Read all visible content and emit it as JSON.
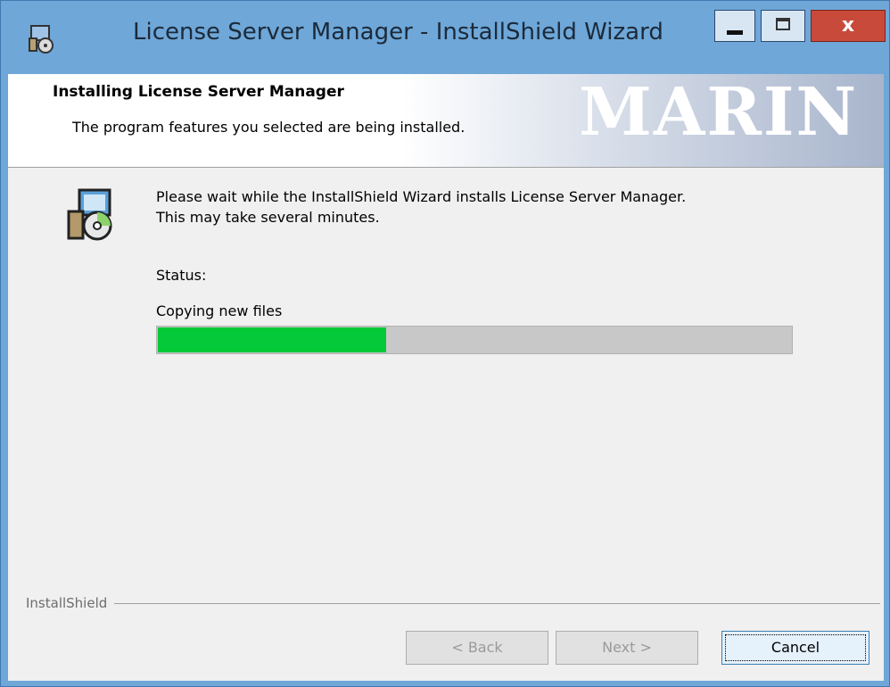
{
  "window": {
    "title": "License Server Manager - InstallShield Wizard",
    "title_buttons": {
      "minimize": "minimize",
      "maximize": "maximize",
      "close": "x"
    },
    "icon": "installer-icon"
  },
  "banner": {
    "title": "Installing License Server Manager",
    "subtitle": "The program features you selected are being installed.",
    "logo_text": "MARIN"
  },
  "body": {
    "message_line1": "Please wait while the InstallShield Wizard installs License Server Manager.",
    "message_line2": "This may take several minutes.",
    "status_label": "Status:",
    "status_value": "Copying new files",
    "progress_fraction": 0.36,
    "progress_color": "#06c93a"
  },
  "footer": {
    "brand": "InstallShield",
    "buttons": {
      "back": "< Back",
      "next": "Next >",
      "cancel": "Cancel"
    }
  },
  "colors": {
    "frame": "#6ea7d8",
    "close_button": "#c74a3b"
  }
}
